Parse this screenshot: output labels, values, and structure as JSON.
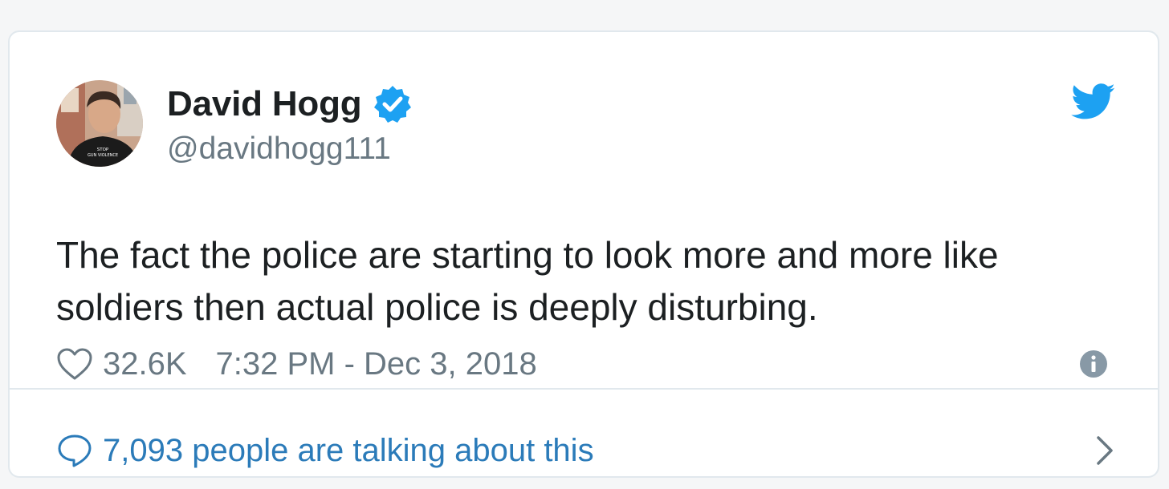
{
  "author": {
    "display_name": "David Hogg",
    "handle": "@davidhogg111",
    "verified": true,
    "avatar_shirt_text": "STOP GUN VIOLENCE"
  },
  "tweet": {
    "text_line1": "The fact the police are starting to look more and more like",
    "text_line2": "soldiers then actual police is deeply disturbing.",
    "likes": "32.6K",
    "timestamp": "7:32 PM - Dec 3, 2018"
  },
  "footer": {
    "talking_text": "7,093 people are talking about this"
  },
  "icons": {
    "avatar": "profile-photo",
    "verified": "verified-badge-icon",
    "brand": "twitter-bird-icon",
    "like": "heart-icon",
    "info": "info-icon",
    "reply": "speech-bubble-icon",
    "navigate": "chevron-right-icon"
  },
  "colors": {
    "twitter_blue": "#1da1f2",
    "link_blue": "#2b7bb9",
    "text_dark": "#1c2022",
    "text_gray": "#697882",
    "border": "#e1e8ed"
  }
}
